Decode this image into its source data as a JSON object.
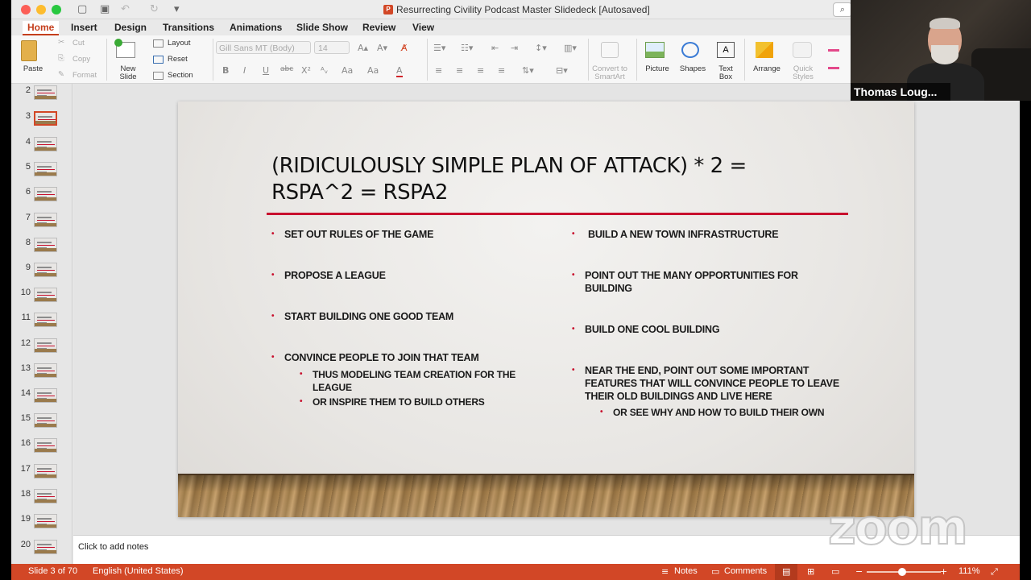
{
  "window": {
    "title": "Resurrecting Civility Podcast Master Slidedeck [Autosaved]"
  },
  "ribbon_tabs": [
    "Home",
    "Insert",
    "Design",
    "Transitions",
    "Animations",
    "Slide Show",
    "Review",
    "View"
  ],
  "ribbon": {
    "paste": "Paste",
    "cut": "Cut",
    "copy": "Copy",
    "format": "Format",
    "new_slide_line1": "New",
    "new_slide_line2": "Slide",
    "layout": "Layout",
    "reset": "Reset",
    "section": "Section",
    "font_name": "Gill Sans MT (Body)",
    "font_size": "14",
    "convert_line1": "Convert to",
    "convert_line2": "SmartArt",
    "picture": "Picture",
    "shapes": "Shapes",
    "textbox_line1": "Text",
    "textbox_line2": "Box",
    "arrange": "Arrange",
    "quick_styles_line1": "Quick",
    "quick_styles_line2": "Styles"
  },
  "thumbnails": [
    "2",
    "3",
    "4",
    "5",
    "6",
    "7",
    "8",
    "9",
    "10",
    "11",
    "12",
    "13",
    "14",
    "15",
    "16",
    "17",
    "18",
    "19",
    "20"
  ],
  "selected_slide": "3",
  "slide": {
    "title_line1": "(RIDICULOUSLY SIMPLE PLAN OF ATTACK) * 2 =",
    "title_line2": "RSPA^2 = RSPA2",
    "left_bullets": [
      "SET OUT RULES OF THE GAME",
      "PROPOSE A LEAGUE",
      "START BUILDING ONE GOOD TEAM",
      "CONVINCE PEOPLE TO JOIN THAT TEAM"
    ],
    "left_sub_bullets": [
      "THUS MODELING TEAM CREATION FOR THE LEAGUE",
      "OR INSPIRE THEM TO BUILD OTHERS"
    ],
    "right_bullets": [
      "BUILD A NEW TOWN INFRASTRUCTURE",
      "POINT OUT THE MANY OPPORTUNITIES FOR BUILDING",
      "BUILD ONE COOL BUILDING",
      "NEAR THE END, POINT OUT SOME IMPORTANT FEATURES THAT WILL CONVINCE PEOPLE TO LEAVE THEIR OLD BUILDINGS AND LIVE HERE"
    ],
    "right_sub_bullets": [
      "OR SEE WHY AND HOW TO BUILD THEIR OWN"
    ]
  },
  "notes_placeholder": "Click to add notes",
  "status": {
    "slide_counter": "Slide 3 of 70",
    "language": "English (United States)",
    "notes": "Notes",
    "comments": "Comments",
    "zoom": "111%"
  },
  "video": {
    "participant_name": "Thomas Loug..."
  },
  "watermark": "zoom",
  "colors": {
    "accent": "#d24726",
    "title_rule": "#c8102e"
  }
}
